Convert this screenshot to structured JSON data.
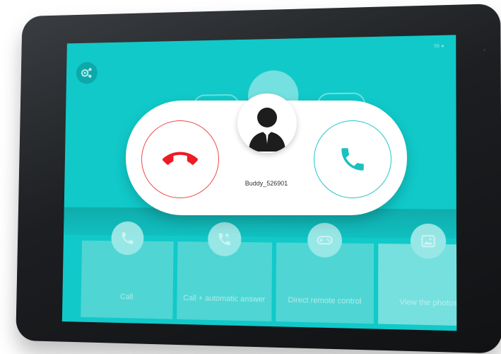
{
  "status_text": "56 ●",
  "caller": {
    "name": "Buddy_526901"
  },
  "tiles": [
    {
      "label": "Call",
      "icon": "phone-icon"
    },
    {
      "label": "Call + automatic answer",
      "icon": "phone-plus-icon"
    },
    {
      "label": "Direct remote control",
      "icon": "gamepad-icon"
    },
    {
      "label": "View the photos",
      "icon": "photo-icon"
    }
  ],
  "colors": {
    "screen": "#11c9c9",
    "decline": "#ee1b24",
    "accept": "#1cc0be"
  }
}
